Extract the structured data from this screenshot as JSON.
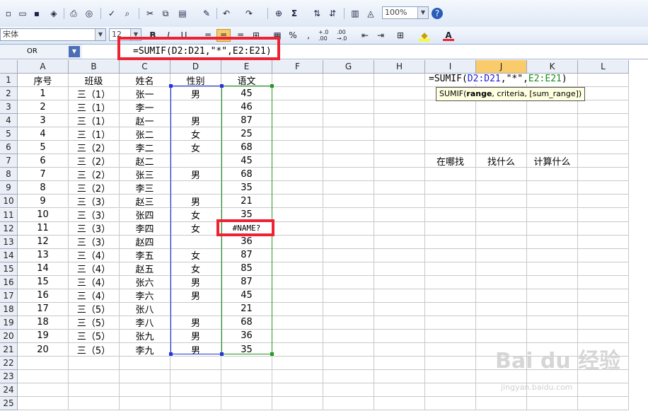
{
  "toolbar": {
    "zoom_value": "100%",
    "sum_symbol": "Σ",
    "font_name": "宋体",
    "font_size": "12",
    "bold_label": "B",
    "italic_label": "I",
    "underline_label": "U",
    "percent_label": "%",
    "comma_label": ",",
    "increase_decimal_label": "+.0 .00",
    "decrease_decimal_label": ".00 →.0",
    "font_color_label": "A",
    "accent_color": "#ee2233"
  },
  "formula_bar": {
    "name_box": "OR",
    "formula": "=SUMIF(D2:D21,\"*\",E2:E21)"
  },
  "columns": [
    "A",
    "B",
    "C",
    "D",
    "E",
    "F",
    "G",
    "H",
    "I",
    "J",
    "K",
    "L"
  ],
  "selected_column": "J",
  "rows": [
    [
      "序号",
      "班级",
      "姓名",
      "性别",
      "语文"
    ],
    [
      "1",
      "三（1）",
      "张一",
      "男",
      "45"
    ],
    [
      "2",
      "三（1）",
      "李一",
      "",
      "46"
    ],
    [
      "3",
      "三（1）",
      "赵一",
      "男",
      "87"
    ],
    [
      "4",
      "三（1）",
      "张二",
      "女",
      "25"
    ],
    [
      "5",
      "三（2）",
      "李二",
      "女",
      "68"
    ],
    [
      "6",
      "三（2）",
      "赵二",
      "",
      "45"
    ],
    [
      "7",
      "三（2）",
      "张三",
      "男",
      "68"
    ],
    [
      "8",
      "三（2）",
      "李三",
      "",
      "35"
    ],
    [
      "9",
      "三（3）",
      "赵三",
      "男",
      "21"
    ],
    [
      "10",
      "三（3）",
      "张四",
      "女",
      "35"
    ],
    [
      "11",
      "三（3）",
      "李四",
      "女",
      "#NAME?"
    ],
    [
      "12",
      "三（3）",
      "赵四",
      "",
      "36"
    ],
    [
      "13",
      "三（4）",
      "李五",
      "女",
      "87"
    ],
    [
      "14",
      "三（4）",
      "赵五",
      "女",
      "85"
    ],
    [
      "15",
      "三（4）",
      "张六",
      "男",
      "87"
    ],
    [
      "16",
      "三（4）",
      "李六",
      "男",
      "45"
    ],
    [
      "17",
      "三（5）",
      "张八",
      "",
      "21"
    ],
    [
      "18",
      "三（5）",
      "李八",
      "男",
      "68"
    ],
    [
      "19",
      "三（5）",
      "张九",
      "男",
      "36"
    ],
    [
      "20",
      "三（5）",
      "李九",
      "男",
      "35"
    ]
  ],
  "row_numbers": [
    "1",
    "2",
    "3",
    "4",
    "5",
    "6",
    "7",
    "8",
    "9",
    "10",
    "11",
    "12",
    "13",
    "14",
    "15",
    "16",
    "17",
    "18",
    "19",
    "20",
    "21",
    "22",
    "23",
    "24",
    "25"
  ],
  "edit": {
    "prefix": "=SUMIF(",
    "range": "D2:D21",
    "middle": ",\"*\",",
    "sum_range": "E2:E21",
    "suffix": ")",
    "range_color": "#1a1adb",
    "sum_range_color": "#1a8a1a"
  },
  "tooltip": {
    "func": "SUMIF(",
    "arg1": "range",
    "rest": ", criteria, [sum_range])"
  },
  "annotations": {
    "i7": "在哪找",
    "j7": "找什么",
    "k7": "计算什么"
  },
  "watermark": {
    "text": "Bai du 经验",
    "sub": "jingyan.baidu.com"
  }
}
